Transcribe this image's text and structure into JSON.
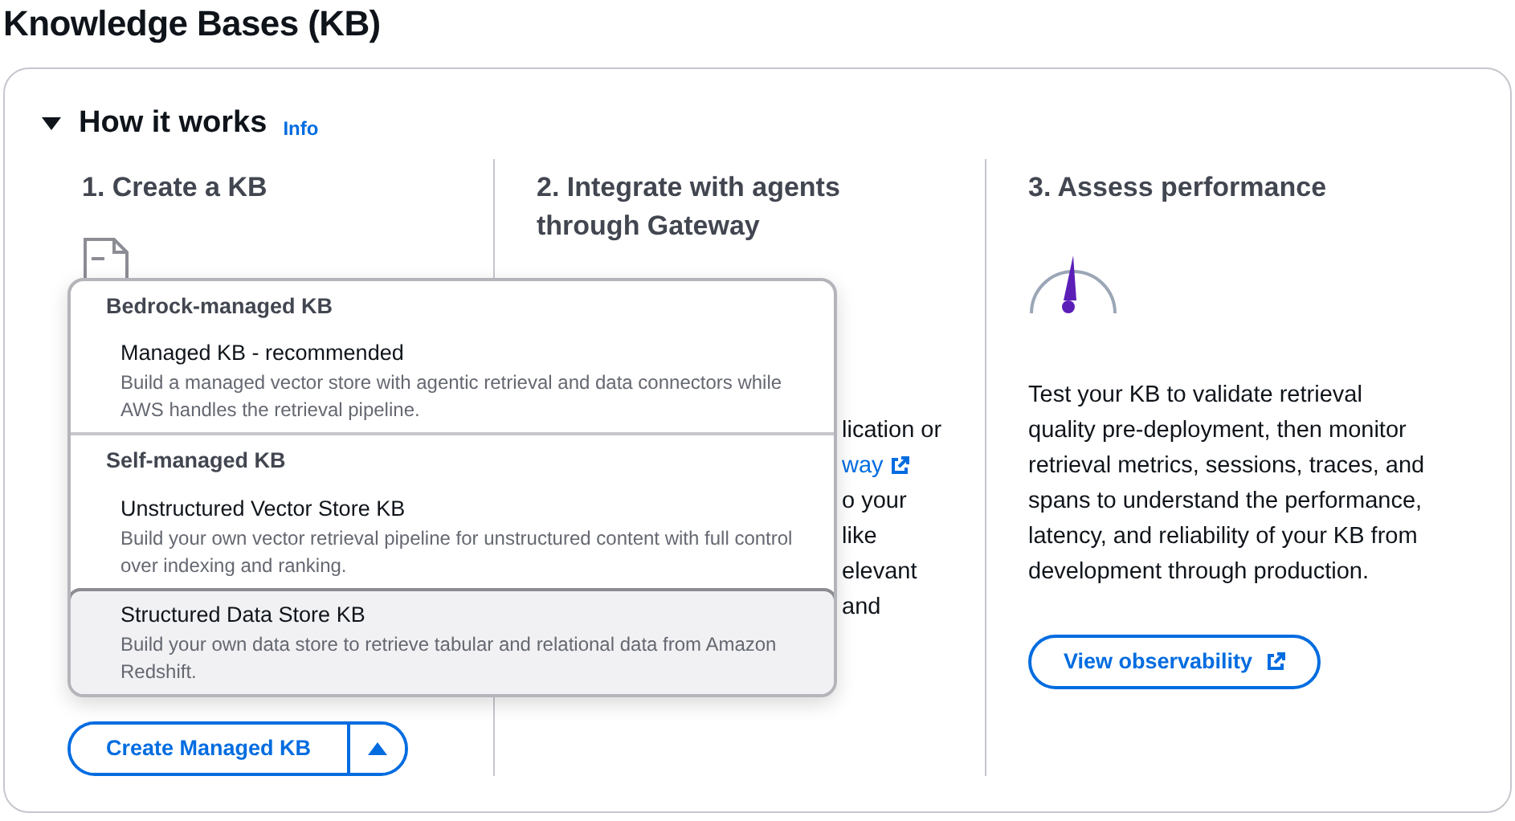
{
  "page_title": "Knowledge Bases (KB)",
  "section": {
    "title": "How it works",
    "expanded": true,
    "info_link": "Info"
  },
  "steps": [
    {
      "title": "1. Create a KB",
      "split_button": {
        "label": "Create Managed KB",
        "menu_open": true
      }
    },
    {
      "title": "2. Integrate with agents through Gateway",
      "visible_lines": [
        {
          "text": "lication or",
          "kind": "text"
        },
        {
          "text": "way",
          "kind": "link"
        },
        {
          "text": "o your",
          "kind": "text"
        },
        {
          "text": "like",
          "kind": "text"
        },
        {
          "text": "elevant",
          "kind": "text"
        },
        {
          "text": "and",
          "kind": "text"
        }
      ]
    },
    {
      "title": "3. Assess performance",
      "description": "Test your KB to validate retrieval quality pre-deployment, then monitor retrieval metrics, sessions, traces, and spans to understand the performance, latency, and reliability of your KB from development through production.",
      "button": "View observability"
    }
  ],
  "dropdown": {
    "groups": [
      {
        "label": "Bedrock-managed KB",
        "options": [
          {
            "label": "Managed KB - recommended",
            "description": "Build a managed vector store with agentic retrieval and data connectors while AWS handles the retrieval pipeline.",
            "selected": false
          }
        ]
      },
      {
        "label": "Self-managed KB",
        "options": [
          {
            "label": "Unstructured Vector Store KB",
            "description": "Build your own vector retrieval pipeline for unstructured content with full control over indexing and ranking.",
            "selected": false
          },
          {
            "label": "Structured Data Store KB",
            "description": "Build your own data store to retrieve tabular and relational data from Amazon Redshift.",
            "selected": true
          }
        ]
      }
    ]
  }
}
